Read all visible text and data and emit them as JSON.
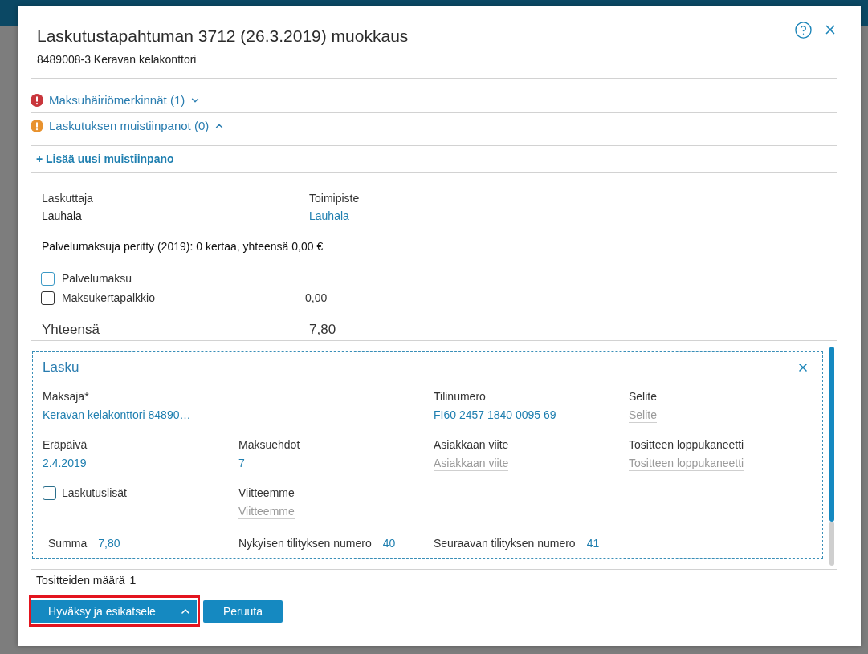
{
  "dialog": {
    "title": "Laskutustapahtuman 3712 (26.3.2019) muokkaus",
    "subtitle": "8489008-3 Keravan kelakonttori"
  },
  "sections": [
    {
      "label": "Maksuhäiriömerkinnät (1)",
      "kind": "error",
      "expanded": false
    },
    {
      "label": "Laskutuksen muistiinpanot (0)",
      "kind": "warning",
      "expanded": true
    }
  ],
  "add_note": {
    "label": "+ Lisää uusi muistiinpano"
  },
  "info": [
    {
      "label": "Laskuttaja",
      "value": "Lauhala",
      "kind": "text"
    },
    {
      "label": "Toimipiste",
      "value": "Lauhala",
      "kind": "link"
    }
  ],
  "fee_summary": "Palvelumaksuja peritty (2019): 0 kertaa, yhteensä 0,00 €",
  "fees": [
    {
      "label": "Palvelumaksu",
      "checked": false,
      "kind": "focused"
    },
    {
      "label": "Maksukertapalkkio",
      "checked": false,
      "kind": "normal",
      "amount": "0,00"
    }
  ],
  "total": {
    "label": "Yhteensä",
    "value": "7,80"
  },
  "invoice": {
    "title": "Lasku",
    "rows": [
      [
        {
          "kind": "value",
          "label": "Maksaja*",
          "value": "Keravan kelakonttori 84890…"
        },
        null,
        {
          "kind": "value",
          "label": "Tilinumero",
          "value": "FI60 2457 1840 0095 69"
        },
        {
          "kind": "input",
          "label": "Selite",
          "placeholder": "Selite"
        }
      ],
      [
        {
          "kind": "value",
          "label": "Eräpäivä",
          "value": "2.4.2019"
        },
        {
          "kind": "value",
          "label": "Maksuehdot",
          "value": "7"
        },
        {
          "kind": "input",
          "label": "Asiakkaan viite",
          "placeholder": "Asiakkaan viite"
        },
        {
          "kind": "input",
          "label": "Tositteen loppukaneetti",
          "placeholder": "Tositteen loppukaneetti"
        }
      ],
      [
        {
          "kind": "checkbox",
          "label": "Laskutuslisät",
          "checked": false
        },
        {
          "kind": "input",
          "label": "Viitteemme",
          "placeholder": "Viitteemme"
        },
        null,
        null
      ]
    ],
    "footer": [
      {
        "label": "Summa",
        "value": "7,80"
      },
      {
        "label": "Nykyisen tilityksen numero",
        "value": "40"
      },
      {
        "label": "Seuraavan tilityksen numero",
        "value": "41"
      }
    ]
  },
  "count": {
    "label": "Tositteiden määrä",
    "value": "1"
  },
  "buttons": [
    {
      "label": "Hyväksy ja esikatsele",
      "kind": "split",
      "highlighted": true
    },
    {
      "label": "Peruuta",
      "kind": "plain",
      "highlighted": false
    }
  ]
}
